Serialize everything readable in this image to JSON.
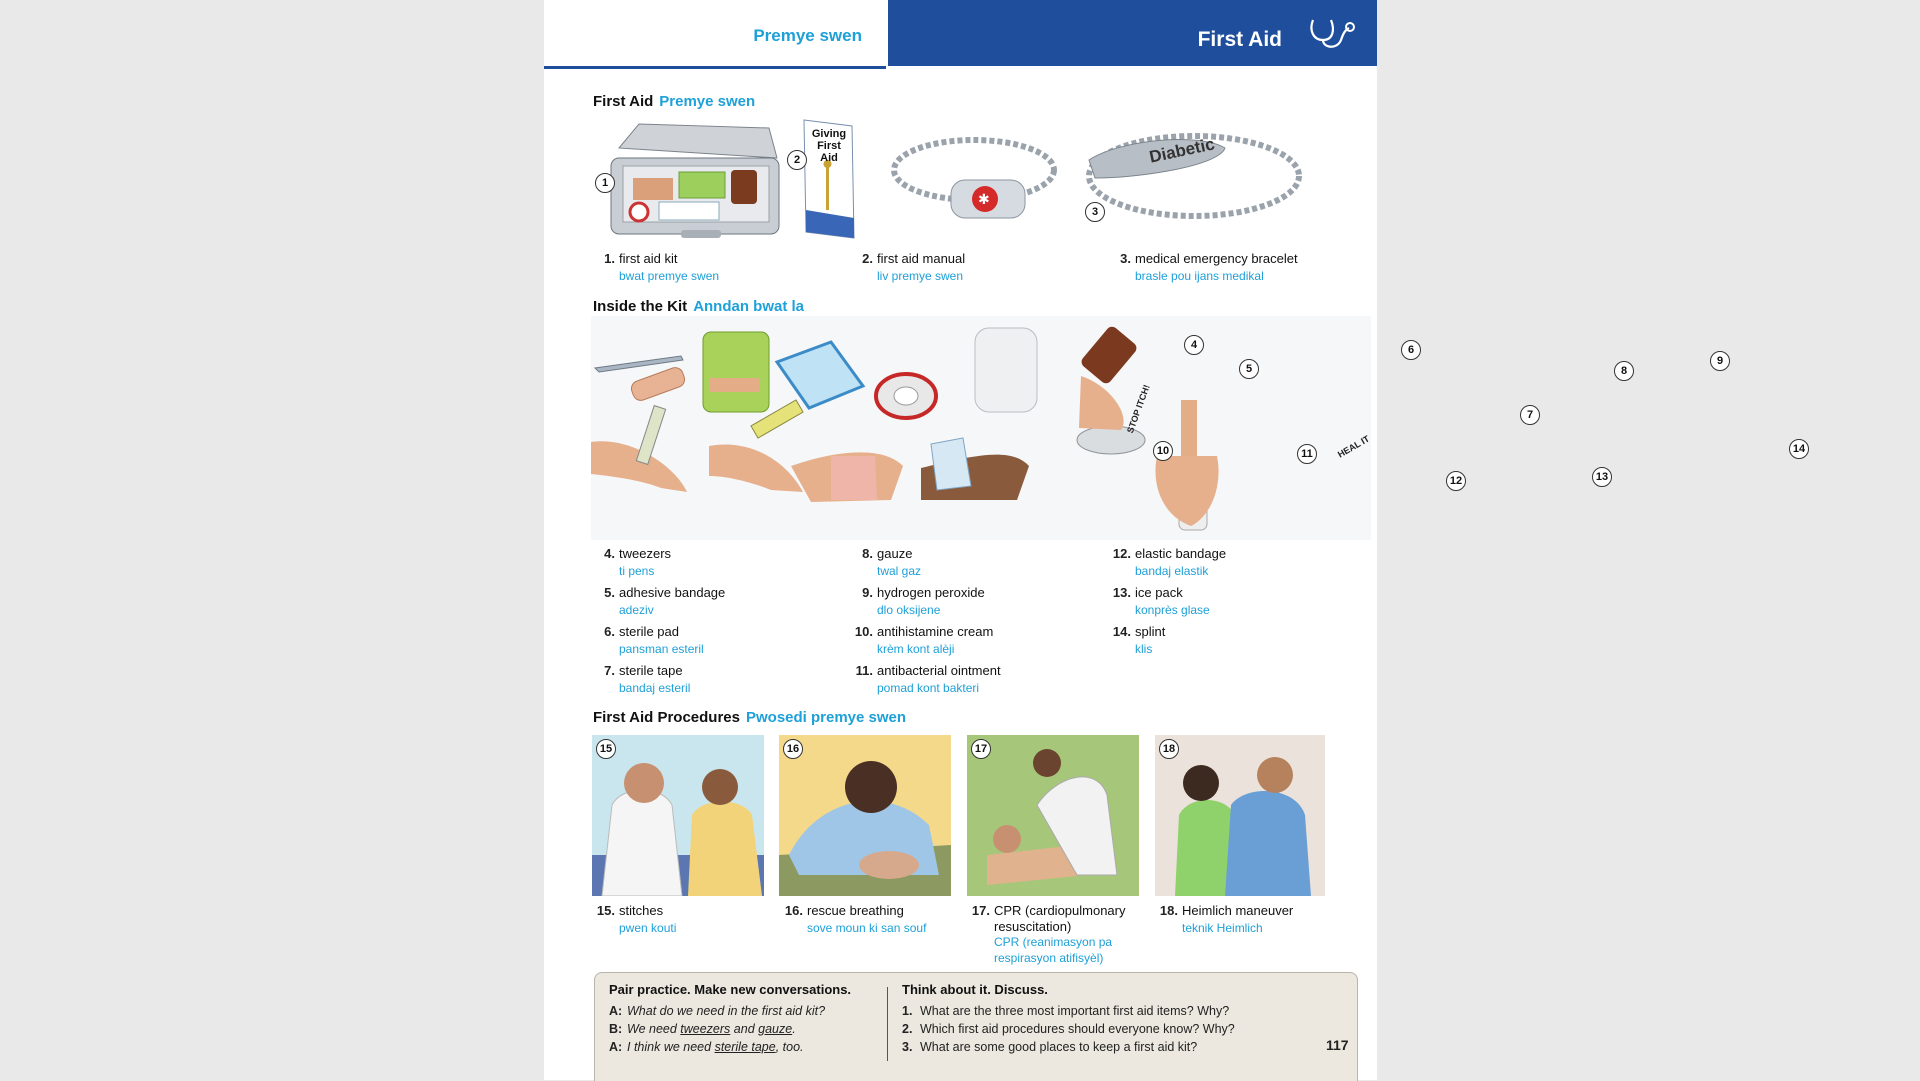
{
  "header": {
    "left_title": "Premye swen",
    "right_title": "First Aid",
    "icon": "stethoscope-icon"
  },
  "sections": {
    "s1": {
      "title": "First Aid",
      "translation": "Premye swen"
    },
    "s2": {
      "title": "Inside the Kit",
      "translation": "Anndan bwat la"
    },
    "s3": {
      "title": "First Aid Procedures",
      "translation": "Pwosedi premye swen"
    }
  },
  "illustration_text": {
    "manual_cover": "Giving First Aid",
    "bracelet_tag": "Diabetic",
    "cream_tube": "STOP ITCH!",
    "ointment_tube": "HEAL IT"
  },
  "items": [
    {
      "num": "1.",
      "badge": "1",
      "en": "first aid kit",
      "ht": "bwat premye swen"
    },
    {
      "num": "2.",
      "badge": "2",
      "en": "first aid manual",
      "ht": "liv premye swen"
    },
    {
      "num": "3.",
      "badge": "3",
      "en": "medical emergency bracelet",
      "ht": "brasle pou ijans medikal"
    },
    {
      "num": "4.",
      "badge": "4",
      "en": "tweezers",
      "ht": "ti pens"
    },
    {
      "num": "5.",
      "badge": "5",
      "en": "adhesive bandage",
      "ht": "adeziv"
    },
    {
      "num": "6.",
      "badge": "6",
      "en": "sterile pad",
      "ht": "pansman esteril"
    },
    {
      "num": "7.",
      "badge": "7",
      "en": "sterile tape",
      "ht": "bandaj esteril"
    },
    {
      "num": "8.",
      "badge": "8",
      "en": "gauze",
      "ht": "twal gaz"
    },
    {
      "num": "9.",
      "badge": "9",
      "en": "hydrogen peroxide",
      "ht": "dlo oksijene"
    },
    {
      "num": "10.",
      "badge": "10",
      "en": "antihistamine cream",
      "ht": "krèm kont alèji"
    },
    {
      "num": "11.",
      "badge": "11",
      "en": "antibacterial ointment",
      "ht": "pomad kont bakteri"
    },
    {
      "num": "12.",
      "badge": "12",
      "en": "elastic bandage",
      "ht": "bandaj elastik"
    },
    {
      "num": "13.",
      "badge": "13",
      "en": "ice pack",
      "ht": "konprès glase"
    },
    {
      "num": "14.",
      "badge": "14",
      "en": "splint",
      "ht": "klis"
    },
    {
      "num": "15.",
      "badge": "15",
      "en": "stitches",
      "ht": "pwen kouti"
    },
    {
      "num": "16.",
      "badge": "16",
      "en": "rescue breathing",
      "ht": "sove moun ki san souf"
    },
    {
      "num": "17.",
      "badge": "17",
      "en": "CPR (cardiopulmonary resuscitation)",
      "ht": "CPR (reanimasyon pa respirasyon atifisyèl)"
    },
    {
      "num": "18.",
      "badge": "18",
      "en": "Heimlich maneuver",
      "ht": "teknik Heimlich"
    }
  ],
  "practice": {
    "heading": "Pair practice. Make new conversations.",
    "a1_label": "A:",
    "a1": "What do we need in the first aid kit?",
    "b_label": "B:",
    "b_pre": "We need ",
    "b_u1": "tweezers",
    "b_mid": " and ",
    "b_u2": "gauze",
    "b_end": ".",
    "a2_label": "A:",
    "a2_pre": "I think we need ",
    "a2_u": "sterile tape",
    "a2_end": ", too."
  },
  "discuss": {
    "heading": "Think about it. Discuss.",
    "q": [
      {
        "n": "1.",
        "text": "What are the three most important first aid items? Why?"
      },
      {
        "n": "2.",
        "text": "Which first aid procedures should everyone know? Why?"
      },
      {
        "n": "3.",
        "text": "What are some good places to keep a first aid kit?"
      }
    ]
  },
  "page_number": "117"
}
